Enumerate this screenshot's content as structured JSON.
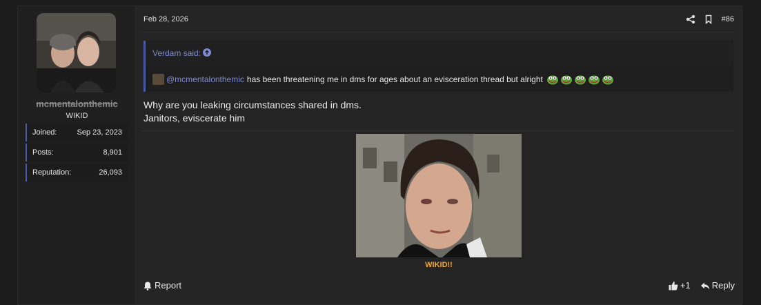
{
  "user": {
    "username": "mcmentalonthemic",
    "title": "WIKID",
    "stats": [
      {
        "label": "Joined:",
        "value": "Sep 23, 2023"
      },
      {
        "label": "Posts:",
        "value": "8,901"
      },
      {
        "label": "Reputation:",
        "value": "26,093"
      }
    ]
  },
  "post": {
    "date": "Feb 28, 2026",
    "number": "#86",
    "quote": {
      "author_line": "Verdam said:",
      "mention": "@mcmentalonthemic",
      "text": "has been threatening me in dms for ages about an evisceration thread but alright"
    },
    "body": [
      "Why are you leaking circumstances shared in dms.",
      "Janitors, eviscerate him"
    ],
    "image_caption": "WIKID!!",
    "footer": {
      "report_label": "Report",
      "reaction_count": "+1",
      "reply_label": "Reply"
    }
  },
  "icons": [
    "share-icon",
    "bookmark-icon",
    "arrow-up-circle-icon",
    "bell-icon",
    "thumbs-up-icon",
    "reply-icon",
    "pepe-emoji-icon"
  ],
  "colors": {
    "accent": "#4b5aa8",
    "link": "#7f89d4",
    "caption": "#f0a830",
    "background": "#1b1b1b",
    "card": "#242424"
  }
}
